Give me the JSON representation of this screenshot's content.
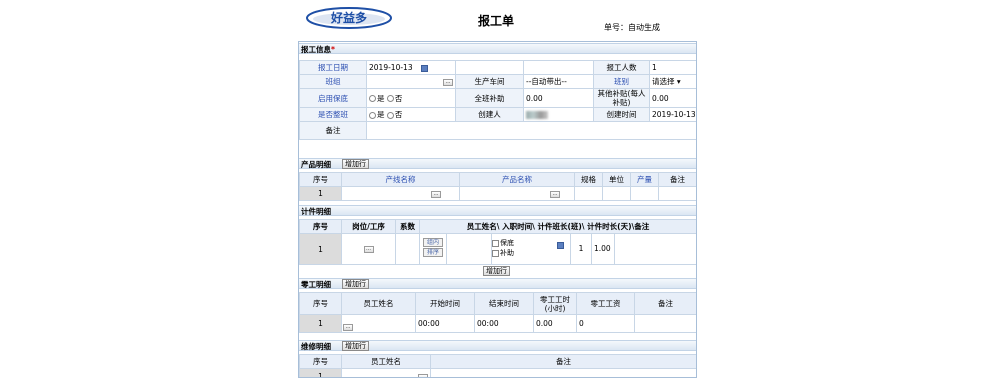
{
  "header": {
    "logo_text": "好益多",
    "title": "报工单",
    "doc_no_label": "单号：",
    "doc_no_value": "自动生成"
  },
  "info": {
    "section_title": "报工信息",
    "required_mark": "*",
    "report_date_label": "报工日期",
    "report_date_value": "2019-10-13",
    "reporter_count_label": "报工人数",
    "reporter_count_value": "1",
    "team_label": "班组",
    "workshop_label": "生产车间",
    "workshop_value": "--自动带出--",
    "shift_label": "班别",
    "shift_value": "请选择",
    "insurance_label": "启用保底",
    "yes": "是",
    "no": "否",
    "full_subsidy_label": "全班补助",
    "full_subsidy_value": "0.00",
    "other_subsidy_label": "其他补贴(每人补贴)",
    "other_subsidy_value": "0.00",
    "whole_shift_label": "是否整班",
    "creator_label": "创建人",
    "create_time_label": "创建时间",
    "create_time_value": "2019-10-13",
    "remark_label": "备注"
  },
  "product": {
    "section_title": "产品明细",
    "add_row": "增加行",
    "headers": [
      "序号",
      "产线名称",
      "产品名称",
      "规格",
      "单位",
      "产量",
      "备注"
    ],
    "row_no": "1"
  },
  "piece": {
    "section_title": "计件明细",
    "headers": [
      "序号",
      "岗位/工序",
      "系数",
      "员工姓名\\ 入职时间\\ 计件班长(班)\\ 计件时长(天)\\备注"
    ],
    "row_no": "1",
    "group_btn": "组内",
    "sort_btn": "排序",
    "insurance_opt": "保底",
    "subsidy_opt": "补助",
    "qty": "1",
    "hours": "1.00",
    "add_row": "增加行"
  },
  "odd": {
    "section_title": "零工明细",
    "add_row": "增加行",
    "headers": [
      "序号",
      "员工姓名",
      "开始时间",
      "结束时间",
      "零工工时(小时)",
      "零工工资",
      "备注"
    ],
    "row": {
      "no": "1",
      "start": "00:00",
      "end": "00:00",
      "hours": "0.00",
      "wage": "0"
    }
  },
  "repair": {
    "section_title": "维修明细",
    "add_row": "增加行",
    "headers": [
      "序号",
      "员工姓名",
      "备注"
    ],
    "row_no": "1"
  }
}
